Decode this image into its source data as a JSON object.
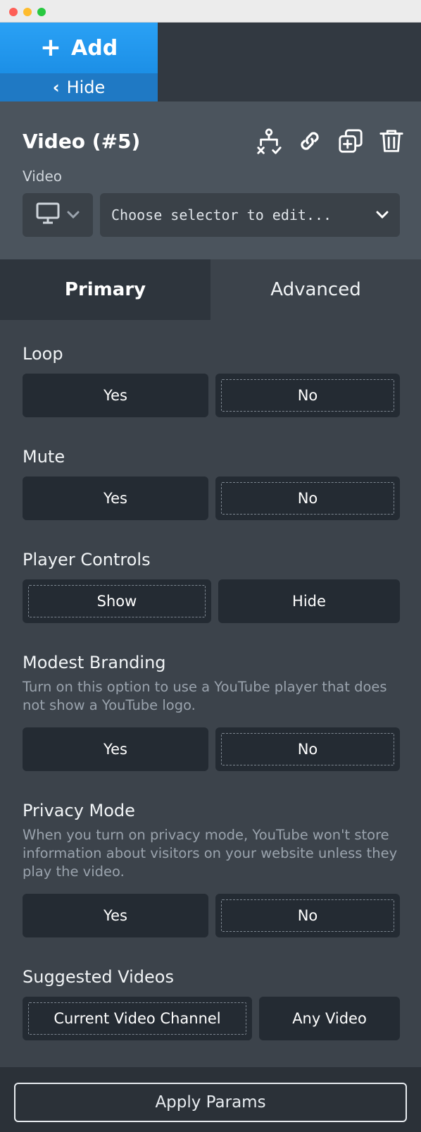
{
  "toolbar": {
    "add_label": "Add",
    "hide_label": "Hide"
  },
  "header": {
    "title": "Video (#5)",
    "subtitle": "Video",
    "icons": [
      "structure-icon",
      "link-icon",
      "duplicate-icon",
      "trash-icon"
    ],
    "device_icon": "desktop-icon",
    "selector_placeholder": "Choose selector to edit..."
  },
  "tabs": [
    {
      "label": "Primary",
      "active": true
    },
    {
      "label": "Advanced",
      "active": false
    }
  ],
  "fields": [
    {
      "label": "Loop",
      "desc": "",
      "options": [
        "Yes",
        "No"
      ],
      "selected": "No"
    },
    {
      "label": "Mute",
      "desc": "",
      "options": [
        "Yes",
        "No"
      ],
      "selected": "No"
    },
    {
      "label": "Player Controls",
      "desc": "",
      "options": [
        "Show",
        "Hide"
      ],
      "selected": "Show"
    },
    {
      "label": "Modest Branding",
      "desc": "Turn on this option to use a YouTube player that does not show a YouTube logo.",
      "options": [
        "Yes",
        "No"
      ],
      "selected": "No"
    },
    {
      "label": "Privacy Mode",
      "desc": "When you turn on privacy mode, YouTube won't store information about visitors on your website unless they play the video.",
      "options": [
        "Yes",
        "No"
      ],
      "selected": "No"
    },
    {
      "label": "Suggested Videos",
      "desc": "",
      "options": [
        "Current Video Channel",
        "Any Video"
      ],
      "selected": "Current Video Channel"
    }
  ],
  "footer": {
    "apply_label": "Apply Params"
  },
  "colors": {
    "accent": "#1c8fe6",
    "panel": "#3c434b",
    "button": "#242b33"
  }
}
